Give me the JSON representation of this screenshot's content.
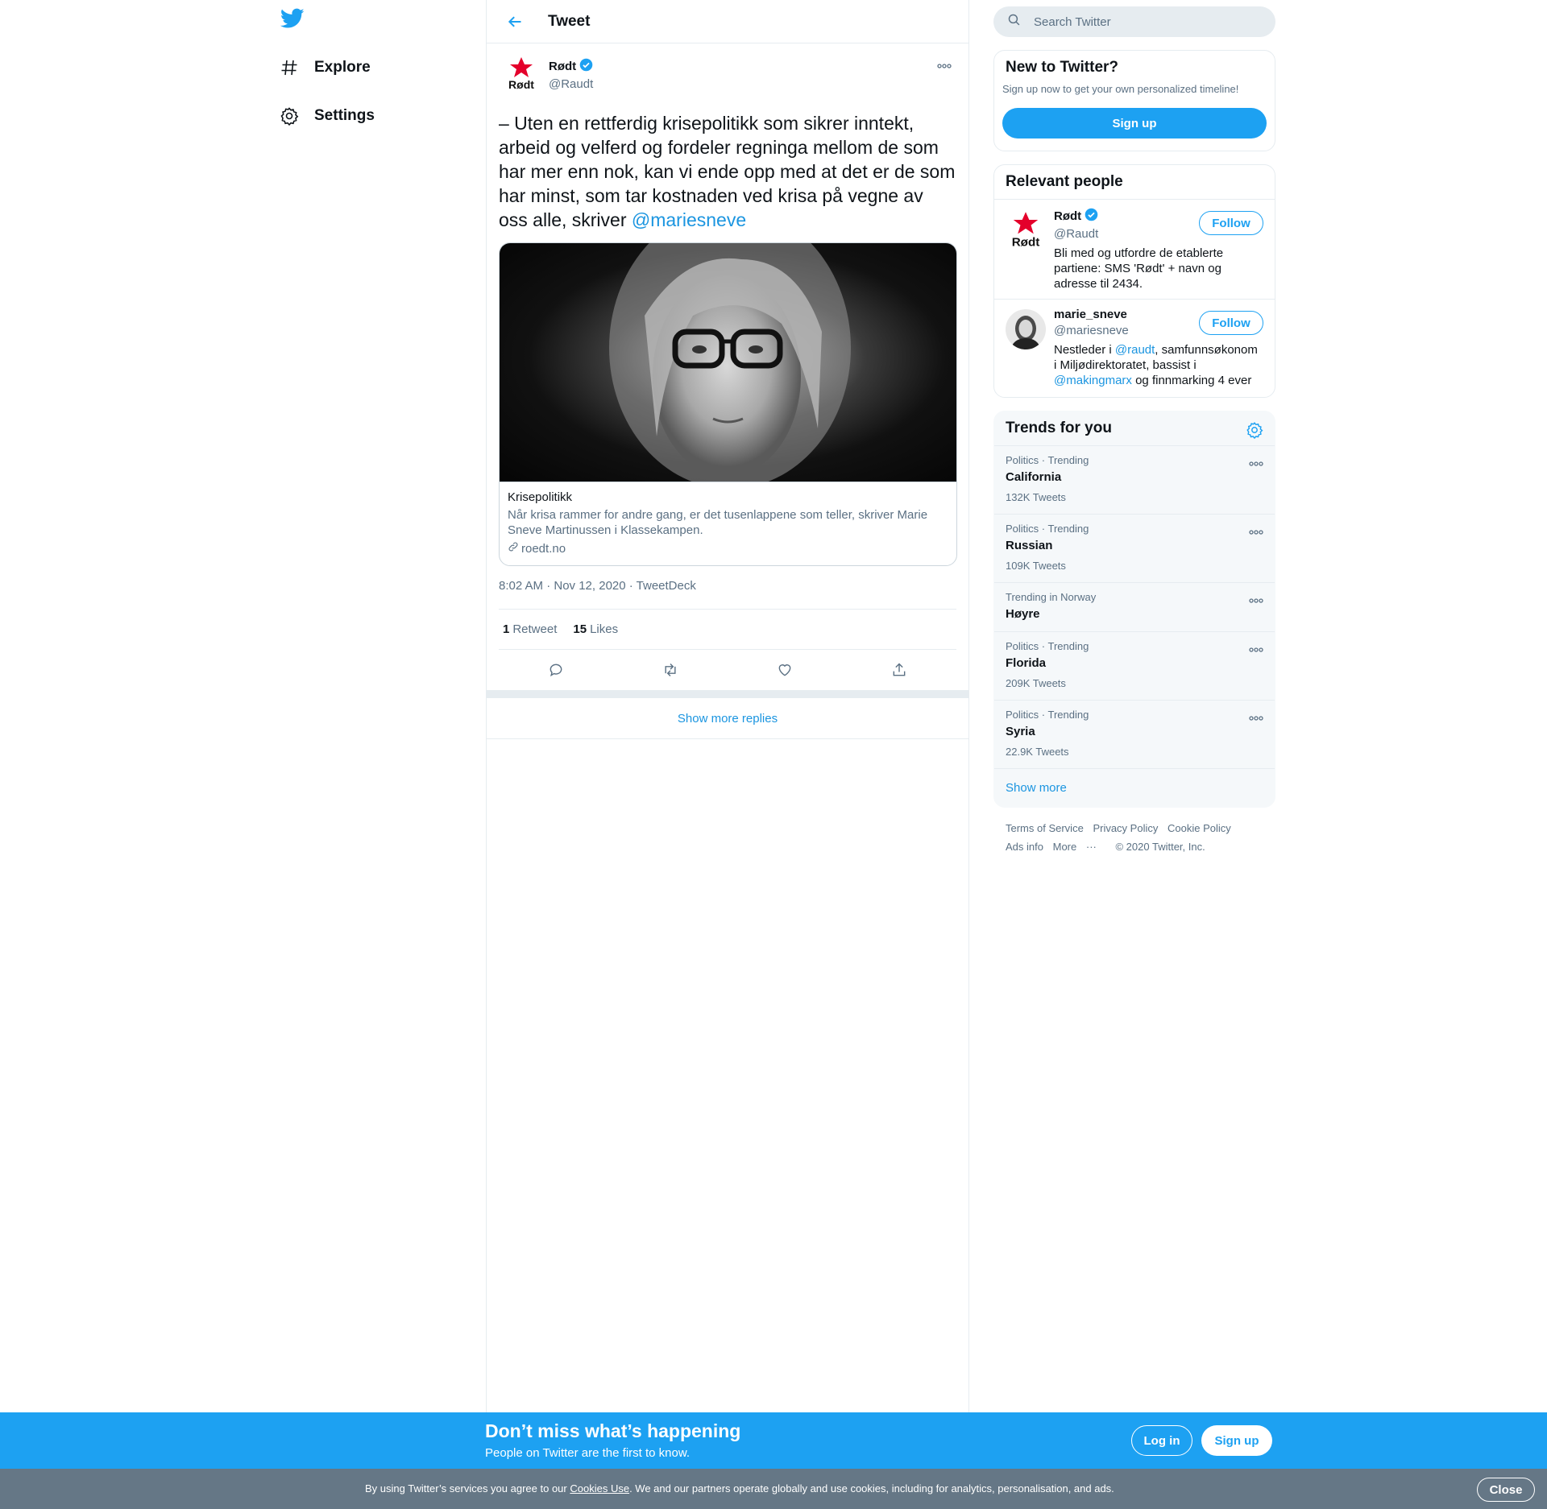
{
  "nav": {
    "items": [
      {
        "label": "Explore",
        "icon": "hashtag-icon"
      },
      {
        "label": "Settings",
        "icon": "gear-icon"
      }
    ]
  },
  "header": {
    "title": "Tweet"
  },
  "tweet": {
    "author_name": "Rødt",
    "author_handle": "@Raudt",
    "avatar_text": "Rødt",
    "text": "– Uten en rettferdig krisepolitikk som sikrer inntekt, arbeid og velferd og fordeler regninga mellom de som har mer enn nok, kan vi ende opp med at det er de som har minst, som tar kostnaden ved krisa på vegne av oss alle, skriver ",
    "mention": "@mariesneve",
    "card": {
      "title": "Krisepolitikk",
      "description": "Når krisa rammer for andre gang, er det tusenlappene som teller, skriver Marie Sneve Martinussen i Klassekampen.",
      "link": "roedt.no"
    },
    "meta": "8:02 AM · Nov 12, 2020 · TweetDeck",
    "retweets_num": "1",
    "retweets_label": "Retweet",
    "likes_num": "15",
    "likes_label": "Likes"
  },
  "replies": {
    "show_more": "Show more replies"
  },
  "search": {
    "placeholder": "Search Twitter"
  },
  "new_to_twitter": {
    "title": "New to Twitter?",
    "subtitle": "Sign up now to get your own personalized timeline!",
    "button": "Sign up"
  },
  "relevant": {
    "title": "Relevant people",
    "people": [
      {
        "name": "Rødt",
        "handle": "@Raudt",
        "bio": "Bli med og utfordre de etablerte partiene: SMS 'Rødt' + navn og adresse til 2434.",
        "follow": "Follow",
        "avatar_text": "Rødt"
      },
      {
        "name": "marie_sneve",
        "handle": "@mariesneve",
        "bio_1": "Nestleder i ",
        "bio_mention_1": "@raudt",
        "bio_2": ", samfunnsøkonom i Miljødirektoratet, bassist i ",
        "bio_mention_2": "@makingmarx",
        "bio_3": " og finnmarking 4 ever",
        "follow": "Follow"
      }
    ]
  },
  "trends": {
    "title": "Trends for you",
    "items": [
      {
        "meta": "Politics · Trending",
        "name": "California",
        "count": "132K Tweets"
      },
      {
        "meta": "Politics · Trending",
        "name": "Russian",
        "count": "109K Tweets"
      },
      {
        "meta": "Trending in Norway",
        "name": "Høyre",
        "count": ""
      },
      {
        "meta": "Politics · Trending",
        "name": "Florida",
        "count": "209K Tweets"
      },
      {
        "meta": "Politics · Trending",
        "name": "Syria",
        "count": "22.9K Tweets"
      }
    ],
    "show_more": "Show more"
  },
  "footer": {
    "links": [
      "Terms of Service",
      "Privacy Policy",
      "Cookie Policy",
      "Ads info",
      "More",
      "© 2020 Twitter, Inc."
    ]
  },
  "banner": {
    "title": "Don’t miss what’s happening",
    "subtitle": "People on Twitter are the first to know.",
    "login": "Log in",
    "signup": "Sign up"
  },
  "cookie": {
    "text_1": "By using Twitter’s services you agree to our ",
    "link": "Cookies Use",
    "text_2": ". We and our partners operate globally and use cookies, including for analytics, personalisation, and ads.",
    "close": "Close"
  },
  "colors": {
    "accent": "#1da1f2",
    "link": "#1b95e0",
    "rodt_red": "#e4002b"
  }
}
